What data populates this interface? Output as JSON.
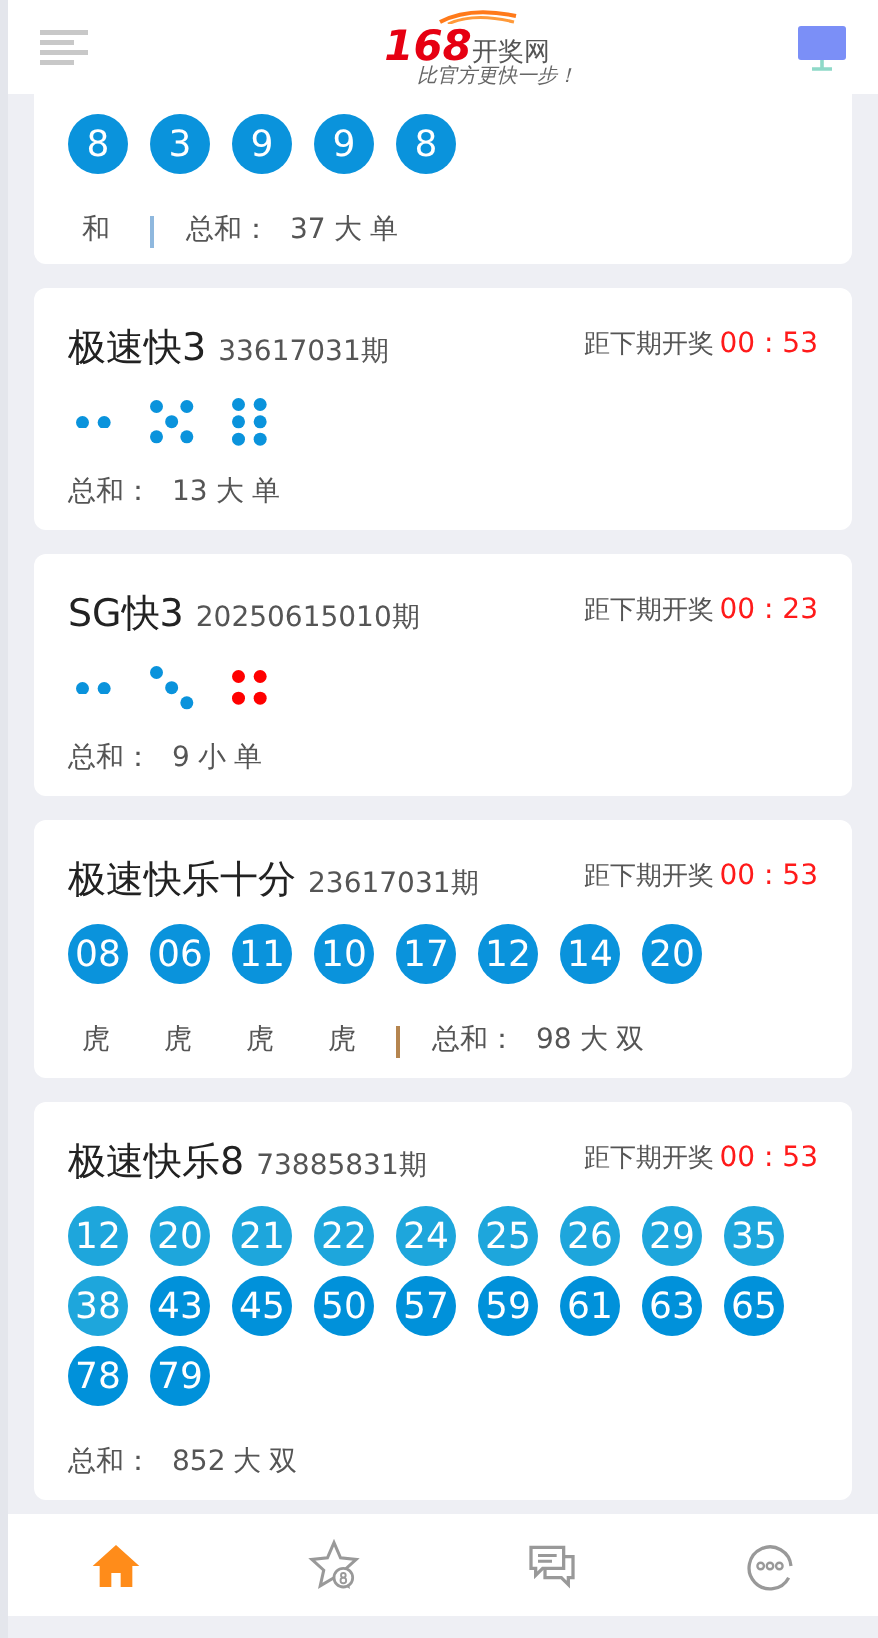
{
  "header": {
    "logo": {
      "number": "168",
      "name": "开奖网",
      "slogan": "比官方更快一步！"
    }
  },
  "cards": [
    {
      "partial": true,
      "kind": "balls",
      "balls": [
        {
          "text": "8",
          "color": "#0a93dc"
        },
        {
          "text": "3",
          "color": "#0a93dc"
        },
        {
          "text": "9",
          "color": "#0a93dc"
        },
        {
          "text": "9",
          "color": "#0a93dc"
        },
        {
          "text": "8",
          "color": "#0a93dc"
        }
      ],
      "footer": {
        "tags": [
          "和"
        ],
        "divider": {
          "color": "#8fb8de"
        },
        "sum_label": "总和：",
        "sum": "37",
        "size": "大",
        "parity": "单"
      }
    },
    {
      "partial": false,
      "title": "极速快3",
      "issue": "33617031期",
      "countdown_label": "距下期开奖",
      "countdown": "00 : 53",
      "kind": "dice",
      "dice": [
        {
          "kind": "two",
          "color": "#0a93dc"
        },
        {
          "kind": "five",
          "color": "#0a93dc"
        },
        {
          "kind": "six",
          "color": "#0a93dc"
        }
      ],
      "footer": {
        "sum_label": "总和：",
        "sum": "13",
        "size": "大",
        "parity": "单"
      }
    },
    {
      "partial": false,
      "title": "SG快3",
      "issue": "20250615010期",
      "countdown_label": "距下期开奖",
      "countdown": "00 : 23",
      "kind": "dice",
      "dice": [
        {
          "kind": "two",
          "color": "#0a93dc"
        },
        {
          "kind": "three",
          "color": "#0a93dc"
        },
        {
          "kind": "four",
          "color": "#ff0000"
        }
      ],
      "footer": {
        "sum_label": "总和：",
        "sum": "9",
        "size": "小",
        "parity": "单"
      }
    },
    {
      "partial": false,
      "title": "极速快乐十分",
      "issue": "23617031期",
      "countdown_label": "距下期开奖",
      "countdown": "00 : 53",
      "kind": "balls",
      "balls": [
        {
          "text": "08",
          "color": "#0a93dc"
        },
        {
          "text": "06",
          "color": "#0a93dc"
        },
        {
          "text": "11",
          "color": "#0a93dc"
        },
        {
          "text": "10",
          "color": "#0a93dc"
        },
        {
          "text": "17",
          "color": "#0a93dc"
        },
        {
          "text": "12",
          "color": "#0a93dc"
        },
        {
          "text": "14",
          "color": "#0a93dc"
        },
        {
          "text": "20",
          "color": "#0a93dc"
        }
      ],
      "footer": {
        "tags": [
          "虎",
          "虎",
          "虎",
          "虎"
        ],
        "divider": {
          "color": "#b5854f"
        },
        "sum_label": "总和：",
        "sum": "98",
        "size": "大",
        "parity": "双"
      }
    },
    {
      "partial": false,
      "title": "极速快乐8",
      "issue": "73885831期",
      "countdown_label": "距下期开奖",
      "countdown": "00 : 53",
      "kind": "balls",
      "balls": [
        {
          "text": "12",
          "color": "#1ea6dc"
        },
        {
          "text": "20",
          "color": "#1ea6dc"
        },
        {
          "text": "21",
          "color": "#1ea6dc"
        },
        {
          "text": "22",
          "color": "#1ea6dc"
        },
        {
          "text": "24",
          "color": "#1ea6dc"
        },
        {
          "text": "25",
          "color": "#1ea6dc"
        },
        {
          "text": "26",
          "color": "#1ea6dc"
        },
        {
          "text": "29",
          "color": "#1ea6dc"
        },
        {
          "text": "35",
          "color": "#1ea6dc"
        },
        {
          "text": "38",
          "color": "#1ea6dc"
        },
        {
          "text": "43",
          "color": "#0091da"
        },
        {
          "text": "45",
          "color": "#0091da"
        },
        {
          "text": "50",
          "color": "#0091da"
        },
        {
          "text": "57",
          "color": "#0091da"
        },
        {
          "text": "59",
          "color": "#0091da"
        },
        {
          "text": "61",
          "color": "#0091da"
        },
        {
          "text": "63",
          "color": "#0091da"
        },
        {
          "text": "65",
          "color": "#0091da"
        },
        {
          "text": "78",
          "color": "#0091da"
        },
        {
          "text": "79",
          "color": "#0091da"
        }
      ],
      "footer": {
        "sum_label": "总和：",
        "sum": "852",
        "size": "大",
        "parity": "双"
      }
    }
  ],
  "nav": [
    {
      "kind": "home",
      "selected": true
    },
    {
      "kind": "star",
      "selected": false
    },
    {
      "kind": "chat",
      "selected": false
    },
    {
      "kind": "more",
      "selected": false
    }
  ]
}
